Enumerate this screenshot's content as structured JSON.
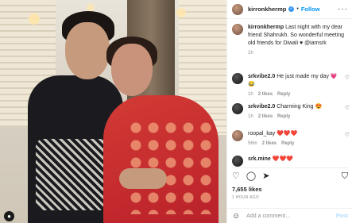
{
  "post": {
    "username": "kirronkhermp",
    "follow_label": "Follow",
    "dot": "•",
    "more": "···",
    "caption_text": "Last night with my dear friend Shahrukh. So wonderful meeting old friends for Diwali ♥ @iamsrk",
    "caption_time": "1h"
  },
  "comments": [
    {
      "user": "srkvibe2.0",
      "text": "He just made my day 💗😂",
      "time": "1h",
      "likes": "2 likes",
      "reply": "Reply"
    },
    {
      "user": "srkvibe2.0",
      "text": "Charming King 😍",
      "time": "1h",
      "likes": "2 likes",
      "reply": "Reply"
    },
    {
      "user": "roopal_kay",
      "text": "❤️❤️❤️",
      "time": "56m",
      "likes": "2 likes",
      "reply": "Reply"
    },
    {
      "user": "srk.mine",
      "text": "❤️❤️❤️"
    }
  ],
  "stats": {
    "likes": "7,655 likes",
    "time": "1 HOUR AGO"
  },
  "composer": {
    "placeholder": "Add a comment...",
    "post_label": "Post"
  },
  "icons": {
    "like": "heart-icon",
    "comment": "comment-icon",
    "share": "share-icon",
    "save": "bookmark-icon",
    "emoji": "emoji-icon",
    "tag": "user-tag-icon"
  },
  "colors": {
    "link": "#0095f6",
    "verified": "#3897f0",
    "muted": "#8e8e8e"
  }
}
